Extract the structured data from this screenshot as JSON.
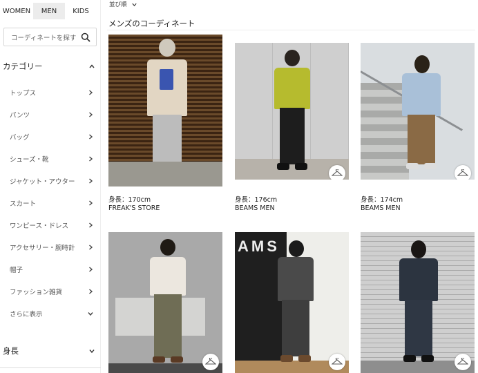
{
  "gender_tabs": [
    "WOMEN",
    "MEN",
    "KIDS"
  ],
  "search": {
    "placeholder": "コーディネートを探す"
  },
  "category": {
    "title": "カテゴリー",
    "items": [
      "トップス",
      "パンツ",
      "バッグ",
      "シューズ・靴",
      "ジャケット・アウター",
      "スカート",
      "ワンピース・ドレス",
      "アクセサリー・腕時計",
      "帽子",
      "ファッション雑貨",
      "さらに表示"
    ]
  },
  "height_filter": {
    "title": "身長"
  },
  "sort": {
    "label": "並び順"
  },
  "page_title": "メンズのコーディネート",
  "cards": [
    {
      "height": "身長：170cm",
      "shop": "FREAK'S STORE"
    },
    {
      "height": "身長：176cm",
      "shop": "BEAMS MEN"
    },
    {
      "height": "身長：174cm",
      "shop": "BEAMS MEN"
    },
    {
      "height": "",
      "shop": ""
    },
    {
      "height": "",
      "shop": ""
    },
    {
      "height": "",
      "shop": ""
    }
  ],
  "card_sign_text": "AMS",
  "icons": {
    "search": "search-icon",
    "hanger": "hanger-icon",
    "chevron_right": "chevron-right-icon",
    "chevron_up": "chevron-up-icon",
    "chevron_down": "chevron-down-icon"
  }
}
